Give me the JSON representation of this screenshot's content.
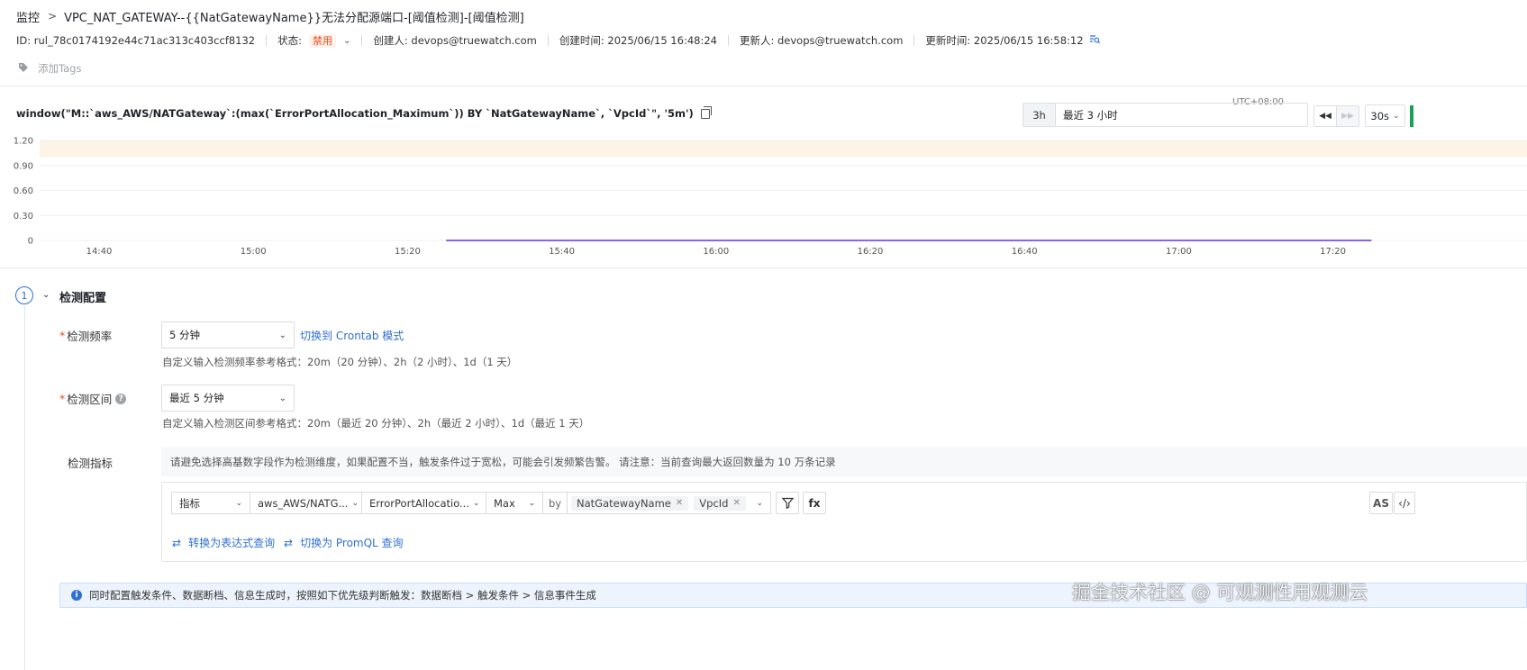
{
  "header": {
    "breadcrumb_root": "监控",
    "separator": ">",
    "title": "VPC_NAT_GATEWAY--{{NatGatewayName}}无法分配源端口-[阈值检测]-[阈值检测]"
  },
  "meta": {
    "id": "ID: rul_78c0174192e44c71ac313c403ccf8132",
    "status_label": "状态:",
    "status_value": "禁用",
    "creator": "创建人: devops@truewatch.com",
    "created_at": "创建时间: 2025/06/15 16:48:24",
    "updater": "更新人: devops@truewatch.com",
    "updated_at": "更新时间: 2025/06/15 16:58:12"
  },
  "tags": {
    "add_label": "添加Tags"
  },
  "query_text": "window(\"M::`aws_AWS/NATGateway`:(max(`ErrorPortAllocation_Maximum`)) BY `NatGatewayName`, `VpcId`\", '5m')",
  "time_controls": {
    "timezone": "UTC+08:00",
    "quick": "3h",
    "range_label": "最近 3 小时",
    "prev_icon": "rewind-icon",
    "next_icon": "fast-forward-icon",
    "refresh": "30s"
  },
  "chart_data": {
    "type": "line",
    "y_ticks": [
      "1.20",
      "0.90",
      "0.60",
      "0.30",
      "0"
    ],
    "x_ticks": [
      "14:40",
      "15:00",
      "15:20",
      "15:40",
      "16:00",
      "16:20",
      "16:40",
      "17:00",
      "17:20"
    ],
    "ylim": [
      0,
      1.2
    ],
    "threshold_band": [
      1.0,
      1.2
    ],
    "series": [
      {
        "x_start": "15:25",
        "x_end": "17:25",
        "values": [
          0,
          0
        ],
        "color": "#7c4ddb"
      }
    ],
    "grid": true,
    "band_color": "#fdf3e7"
  },
  "section": {
    "step_number": "1",
    "title": "检测配置",
    "frequency": {
      "label": "检测频率",
      "value": "5 分钟",
      "switch_link": "切换到 Crontab 模式",
      "hint": "自定义输入检测频率参考格式：20m（20 分钟）、2h（2 小时）、1d（1 天）"
    },
    "interval": {
      "label": "检测区间",
      "value": "最近 5 分钟",
      "hint": "自定义输入检测区间参考格式：20m（最近 20 分钟）、2h（最近 2 小时）、1d（最近 1 天）"
    },
    "metrics": {
      "label": "检测指标",
      "warning": "请避免选择高基数字段作为检测维度，如果配置不当，触发条件过于宽松，可能会引发频繁告警。 请注意：当前查询最大返回数量为 10 万条记录",
      "type": "指标",
      "measurement": "aws_AWS/NATG...",
      "field": "ErrorPortAllocatio...",
      "func": "Max",
      "by": "by",
      "tag1": "NatGatewayName",
      "tag2": "VpcId",
      "as_btn": "AS",
      "fx_btn": "fx",
      "convert_expr": "转换为表达式查询",
      "convert_promql": "切换为 PromQL 查询"
    },
    "info": "同时配置触发条件、数据断档、信息生成时，按照如下优先级判断触发：数据断档 > 触发条件 > 信息事件生成"
  },
  "watermark": "掘金技术社区 @ 可观测性用观测云"
}
